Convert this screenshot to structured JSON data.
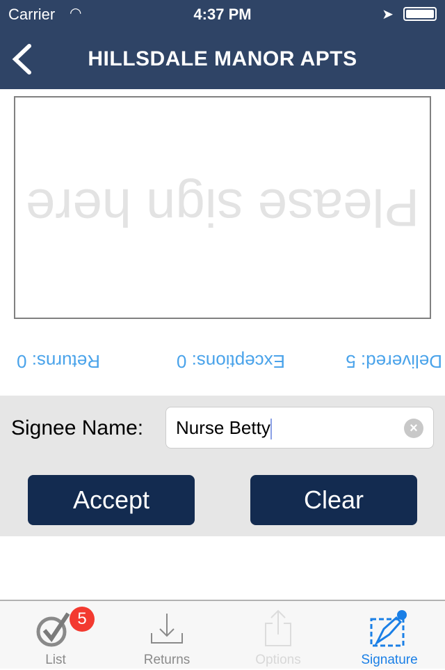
{
  "status": {
    "carrier": "Carrier",
    "time": "4:37 PM"
  },
  "nav": {
    "title": "HILLSDALE MANOR APTS",
    "back_icon": "chevron-left-icon"
  },
  "signature": {
    "placeholder": "Please sign here"
  },
  "stats": {
    "delivered": "Delivered: 5",
    "exceptions": "Exceptions: 0",
    "returns": "Returns: 0"
  },
  "form": {
    "label": "Signee Name:",
    "value": "Nurse Betty",
    "accept": "Accept",
    "clear": "Clear"
  },
  "tabs": [
    {
      "label": "List",
      "badge": "5",
      "icon": "checkmark-circle-icon"
    },
    {
      "label": "Returns",
      "icon": "download-icon"
    },
    {
      "label": "Options",
      "icon": "share-icon",
      "disabled": true
    },
    {
      "label": "Signature",
      "icon": "pen-signature-icon",
      "active": true
    }
  ],
  "colors": {
    "nav": "#2f4466",
    "button": "#132b50",
    "accent": "#1a7fe6",
    "stats": "#4aa3ea",
    "badge": "#f33a30"
  }
}
